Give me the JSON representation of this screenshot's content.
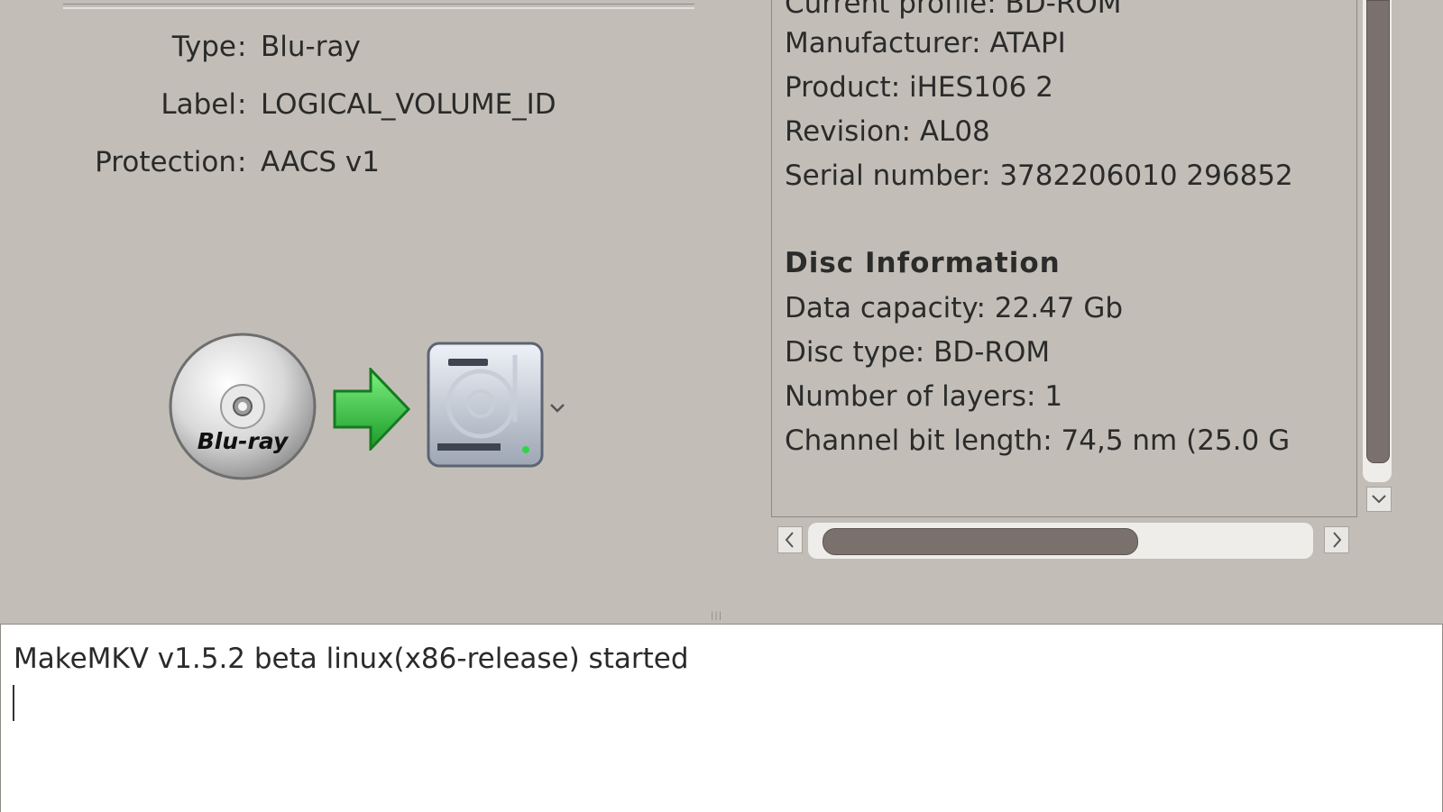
{
  "disc_properties": [
    {
      "label": "Type",
      "value": "Blu-ray"
    },
    {
      "label": "Label",
      "value": "LOGICAL_VOLUME_ID"
    },
    {
      "label": "Protection",
      "value": "AACS v1"
    }
  ],
  "icons": {
    "source": "bluray-disc-icon",
    "source_text": "Blu-ray",
    "arrow": "green-right-arrow-icon",
    "destination": "hard-drive-icon",
    "destination_dropdown": "chevron-down-icon"
  },
  "info_panel": {
    "lines": [
      "Current profile: BD-ROM",
      "Manufacturer: ATAPI",
      "Product: iHES106 2",
      "Revision: AL08",
      "Serial number: 3782206010 296852"
    ],
    "disc_heading": "Disc Information",
    "disc_lines": [
      "Data capacity: 22.47 Gb",
      "Disc type: BD-ROM",
      "Number of layers: 1",
      "Channel bit length: 74,5 nm (25.0 G"
    ]
  },
  "scroll": {
    "left_arrow": "‹",
    "right_arrow": "›",
    "down_arrow": "⌄"
  },
  "splitter_grip": "|||",
  "log": {
    "lines": [
      "MakeMKV v1.5.2 beta linux(x86-release) started"
    ]
  },
  "colors": {
    "window_bg": "#c2beb7",
    "scroll_thumb": "#7a716d",
    "arrow_green": "#2fbf3a"
  }
}
